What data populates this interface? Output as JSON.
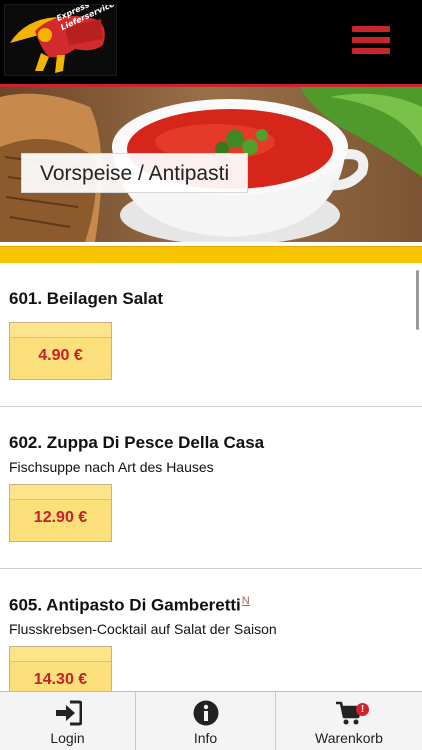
{
  "header": {
    "logo_text_line1": "Express",
    "logo_text_line2": "Lieferservice",
    "menu_icon": "hamburger-menu-icon",
    "accent_color": "#c9252b"
  },
  "hero": {
    "category_title": "Vorspeise / Antipasti"
  },
  "menu_items": [
    {
      "title": "601. Beilagen Salat",
      "description": "",
      "price": "4.90 €",
      "note": ""
    },
    {
      "title": "602. Zuppa Di Pesce Della Casa",
      "description": "Fischsuppe nach Art des Hauses",
      "price": "12.90 €",
      "note": ""
    },
    {
      "title": "605. Antipasto Di Gamberetti",
      "description": "Flusskrebsen-Cocktail auf Salat der Saison",
      "price": "14.30 €",
      "note": "N"
    }
  ],
  "tabbar": {
    "login": {
      "label": "Login",
      "icon": "login-icon"
    },
    "info": {
      "label": "Info",
      "icon": "info-icon"
    },
    "cart": {
      "label": "Warenkorb",
      "icon": "cart-icon",
      "badge": "!"
    }
  },
  "colors": {
    "price_bg": "#fbdf7a",
    "price_text": "#c8202b",
    "yellow_bar": "#f6c400"
  }
}
